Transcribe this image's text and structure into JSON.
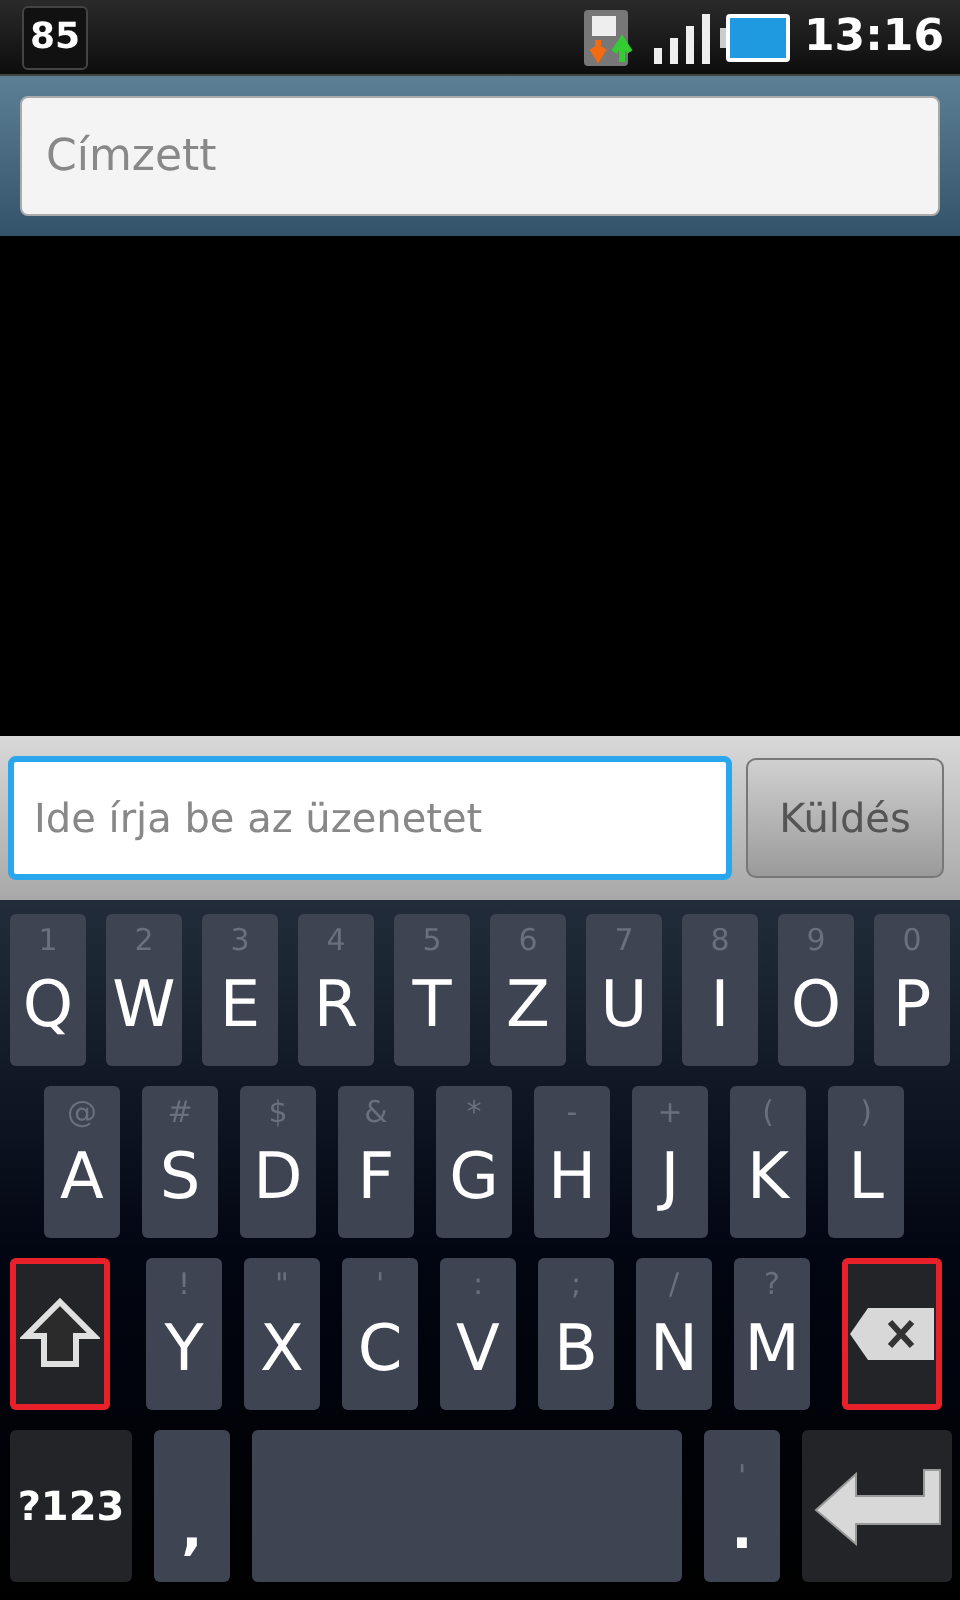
{
  "status_bar": {
    "notification_badge": "85",
    "time": "13:16"
  },
  "recipient": {
    "placeholder": "Címzett"
  },
  "compose": {
    "placeholder": "Ide írja be az üzenetet",
    "send_button": "Küldés"
  },
  "keyboard": {
    "rows": [
      [
        {
          "kind": "letter",
          "label": "Q",
          "hint": "1"
        },
        {
          "kind": "letter",
          "label": "W",
          "hint": "2"
        },
        {
          "kind": "letter",
          "label": "E",
          "hint": "3"
        },
        {
          "kind": "letter",
          "label": "R",
          "hint": "4"
        },
        {
          "kind": "letter",
          "label": "T",
          "hint": "5"
        },
        {
          "kind": "letter",
          "label": "Z",
          "hint": "6"
        },
        {
          "kind": "letter",
          "label": "U",
          "hint": "7"
        },
        {
          "kind": "letter",
          "label": "I",
          "hint": "8"
        },
        {
          "kind": "letter",
          "label": "O",
          "hint": "9"
        },
        {
          "kind": "letter",
          "label": "P",
          "hint": "0"
        }
      ],
      [
        {
          "kind": "letter",
          "label": "A",
          "hint": "@"
        },
        {
          "kind": "letter",
          "label": "S",
          "hint": "#"
        },
        {
          "kind": "letter",
          "label": "D",
          "hint": "$"
        },
        {
          "kind": "letter",
          "label": "F",
          "hint": "&"
        },
        {
          "kind": "letter",
          "label": "G",
          "hint": "*"
        },
        {
          "kind": "letter",
          "label": "H",
          "hint": "-"
        },
        {
          "kind": "letter",
          "label": "J",
          "hint": "+"
        },
        {
          "kind": "letter",
          "label": "K",
          "hint": "("
        },
        {
          "kind": "letter",
          "label": "L",
          "hint": ")"
        }
      ],
      [
        {
          "kind": "shift",
          "highlighted": true
        },
        {
          "kind": "letter",
          "label": "Y",
          "hint": "!"
        },
        {
          "kind": "letter",
          "label": "X",
          "hint": "\""
        },
        {
          "kind": "letter",
          "label": "C",
          "hint": "'"
        },
        {
          "kind": "letter",
          "label": "V",
          "hint": ":"
        },
        {
          "kind": "letter",
          "label": "B",
          "hint": ";"
        },
        {
          "kind": "letter",
          "label": "N",
          "hint": "/"
        },
        {
          "kind": "letter",
          "label": "M",
          "hint": "?"
        },
        {
          "kind": "backspace",
          "highlighted": true
        }
      ],
      [
        {
          "kind": "symbols",
          "label": "?123"
        },
        {
          "kind": "punct",
          "label": ","
        },
        {
          "kind": "space"
        },
        {
          "kind": "punct",
          "label": ".",
          "hint": "'"
        },
        {
          "kind": "enter"
        }
      ]
    ]
  }
}
